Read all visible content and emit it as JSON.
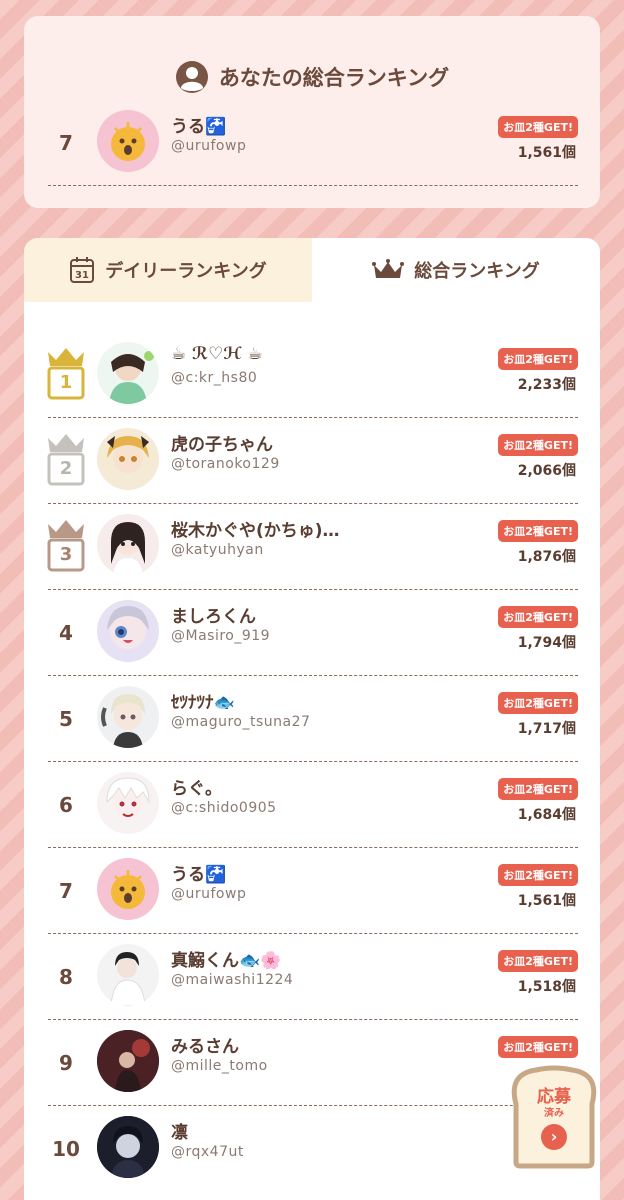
{
  "colors": {
    "accent": "#e8604e",
    "text": "#6b4a3c",
    "gold": "#d9b43a",
    "silver": "#c5c2bd",
    "bronze": "#b89987",
    "tab_inactive": "#fbf1dc"
  },
  "my_ranking": {
    "title": "あなたの総合ランキング",
    "icon": "user-circle-icon",
    "entry": {
      "rank": "7",
      "name": "うる🚰",
      "handle": "@urufowp",
      "badge": "お皿2種GET!",
      "count": "1,561個"
    }
  },
  "tabs": [
    {
      "label": "デイリーランキング",
      "icon": "calendar-31-icon",
      "active": false
    },
    {
      "label": "総合ランキング",
      "icon": "crown-icon",
      "active": true
    }
  ],
  "calendar_day": "31",
  "rankings": [
    {
      "rank": "1",
      "name": "☕ ℛ♡ℋ ☕",
      "handle": "@c:kr_hs80",
      "badge": "お皿2種GET!",
      "count": "2,233個"
    },
    {
      "rank": "2",
      "name": "虎の子ちゃん",
      "handle": "@toranoko129",
      "badge": "お皿2種GET!",
      "count": "2,066個"
    },
    {
      "rank": "3",
      "name": "桜木かぐや(かちゅ)…",
      "handle": "@katyuhyan",
      "badge": "お皿2種GET!",
      "count": "1,876個"
    },
    {
      "rank": "4",
      "name": "ましろくん",
      "handle": "@Masiro_919",
      "badge": "お皿2種GET!",
      "count": "1,794個"
    },
    {
      "rank": "5",
      "name": "ｾﾂﾅﾂﾅ🐟",
      "handle": "@maguro_tsuna27",
      "badge": "お皿2種GET!",
      "count": "1,717個"
    },
    {
      "rank": "6",
      "name": "らぐ。",
      "handle": "@c:shido0905",
      "badge": "お皿2種GET!",
      "count": "1,684個"
    },
    {
      "rank": "7",
      "name": "うる🚰",
      "handle": "@urufowp",
      "badge": "お皿2種GET!",
      "count": "1,561個"
    },
    {
      "rank": "8",
      "name": "真鰯くん🐟🌸",
      "handle": "@maiwashi1224",
      "badge": "お皿2種GET!",
      "count": "1,518個"
    },
    {
      "rank": "9",
      "name": "みるさん",
      "handle": "@mille_tomo",
      "badge": "お皿2種GET!",
      "count": ""
    },
    {
      "rank": "10",
      "name": "凛",
      "handle": "@rqx47ut",
      "badge": "お",
      "count": ""
    }
  ],
  "floating_button": {
    "label": "応募",
    "sub": "済み",
    "icon": "chevron-right-icon"
  }
}
